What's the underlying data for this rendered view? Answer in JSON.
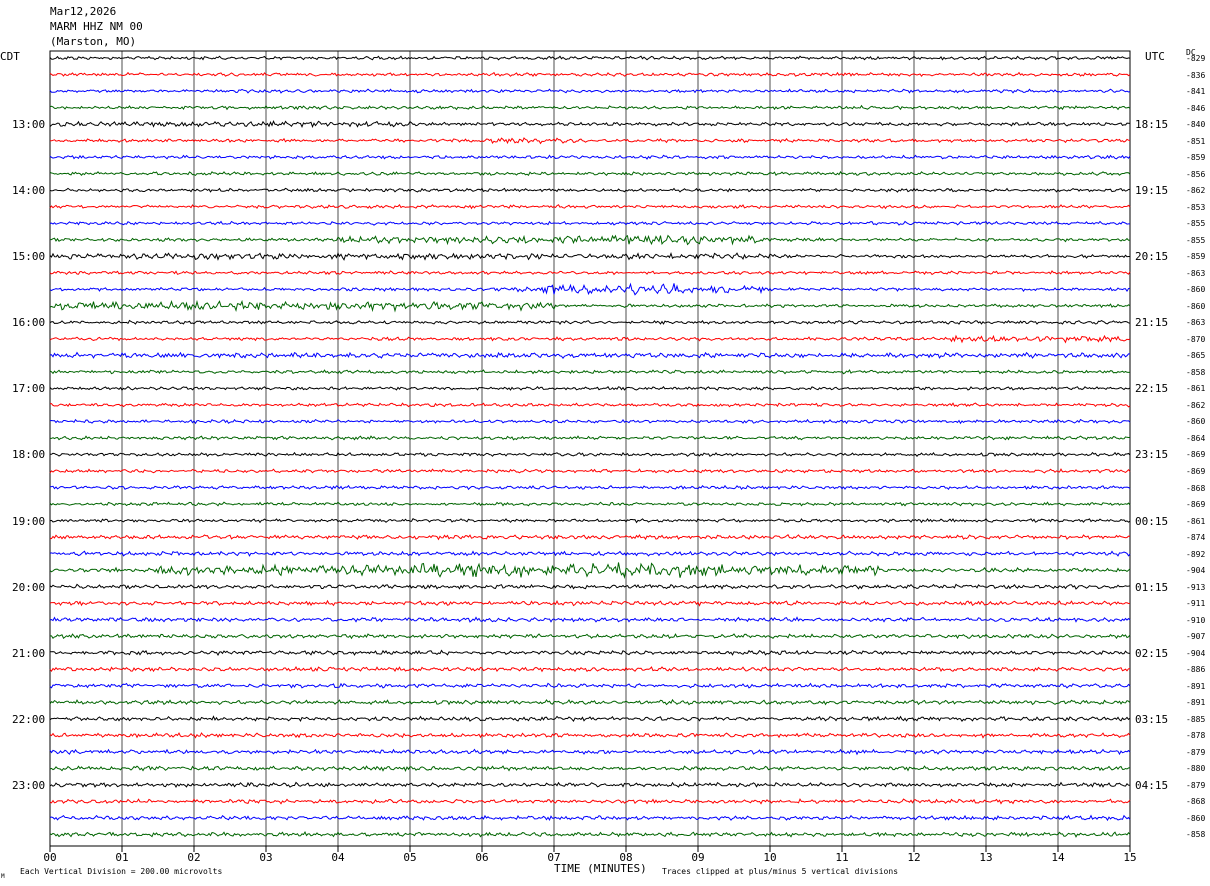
{
  "header": {
    "date": "Mar12,2026",
    "station": "MARM HHZ NM 00",
    "location": "(Marston, MO)"
  },
  "left_zone": "CDT",
  "right_zone": "UTC",
  "dc_label": "DC",
  "footer": {
    "xlabel": "TIME (MINUTES)",
    "scale_note": "Each Vertical Division =  200.00 microvolts",
    "clip_note": "Traces clipped at plus/minus 5 vertical divisions",
    "corner_mark": "M"
  },
  "colors": {
    "black": "#000000",
    "red": "#ff0000",
    "blue": "#0000ff",
    "green": "#006400"
  },
  "chart_data": {
    "type": "line",
    "xlabel": "TIME (MINUTES)",
    "x_ticks": [
      "00",
      "01",
      "02",
      "03",
      "04",
      "05",
      "06",
      "07",
      "08",
      "09",
      "10",
      "11",
      "12",
      "13",
      "14",
      "15"
    ],
    "xlim": [
      0,
      15
    ],
    "grid": true,
    "trace_color_cycle": [
      "black",
      "red",
      "blue",
      "green"
    ],
    "left_hour_labels": [
      "13:00",
      "14:00",
      "15:00",
      "16:00",
      "17:00",
      "18:00",
      "19:00",
      "20:00",
      "21:00",
      "22:00",
      "23:00"
    ],
    "right_hour_labels": [
      "18:15",
      "19:15",
      "20:15",
      "21:15",
      "22:15",
      "23:15",
      "00:15",
      "01:15",
      "02:15",
      "03:15",
      "04:15"
    ],
    "dc_offsets": [
      -829,
      -836,
      -841,
      -846,
      -840,
      -851,
      -859,
      -856,
      -862,
      -853,
      -855,
      -855,
      -859,
      -863,
      -860,
      -860,
      -863,
      -870,
      -865,
      -858,
      -861,
      -862,
      -860,
      -864,
      -869,
      -869,
      -868,
      -869,
      -861,
      -874,
      -892,
      -904,
      -913,
      -911,
      -910,
      -907,
      -904,
      -886,
      -891,
      -891,
      -885,
      -878,
      -879,
      -880,
      -879,
      -868,
      -860,
      -858
    ],
    "bursts": [
      {
        "trace": 4,
        "start_min": 0.0,
        "end_min": 5.0,
        "level": 1.6
      },
      {
        "trace": 5,
        "start_min": 6.0,
        "end_min": 7.5,
        "level": 1.5
      },
      {
        "trace": 11,
        "start_min": 4.0,
        "end_min": 10.0,
        "level": 2.2
      },
      {
        "trace": 11,
        "start_min": 7.8,
        "end_min": 9.0,
        "level": 3.2
      },
      {
        "trace": 12,
        "start_min": 0.0,
        "end_min": 10.0,
        "level": 1.9
      },
      {
        "trace": 14,
        "start_min": 6.5,
        "end_min": 10.0,
        "level": 2.4
      },
      {
        "trace": 14,
        "start_min": 6.8,
        "end_min": 8.8,
        "level": 3.4
      },
      {
        "trace": 15,
        "start_min": 0.0,
        "end_min": 7.0,
        "level": 2.6
      },
      {
        "trace": 17,
        "start_min": 12.5,
        "end_min": 15.0,
        "level": 1.8
      },
      {
        "trace": 18,
        "start_min": 0.0,
        "end_min": 15.0,
        "level": 1.5
      },
      {
        "trace": 31,
        "start_min": 1.5,
        "end_min": 11.5,
        "level": 3.2
      },
      {
        "trace": 31,
        "start_min": 5.0,
        "end_min": 9.5,
        "level": 4.2
      }
    ]
  }
}
